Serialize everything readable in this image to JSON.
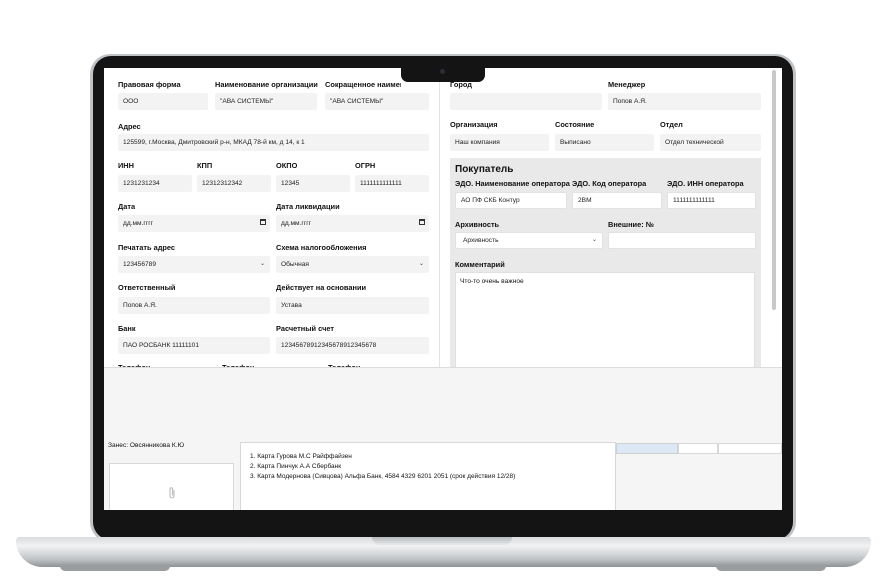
{
  "form": {
    "legal_form_label": "Правовая форма",
    "legal_form_value": "ООО",
    "org_name_label": "Наименование организации",
    "org_name_value": "\"АВА СИСТЕМЫ\"",
    "short_name_label": "Сокращенное наименование",
    "short_name_value": "\"АВА СИСТЕМЫ\"",
    "address_label": "Адрес",
    "address_value": "125599, г.Москва, Дмитровский р-н, МКАД 78-й км, д 14, к 1",
    "inn_label": "ИНН",
    "inn_value": "1231231234",
    "kpp_label": "КПП",
    "kpp_value": "12312312342",
    "okpo_label": "ОКПО",
    "okpo_value": "12345",
    "ogrn_label": "ОГРН",
    "ogrn_value": "1111111111111",
    "date_label": "Дата",
    "date_placeholder": "дд.мм.гггг",
    "liq_date_label": "Дата ликвидации",
    "liq_date_placeholder": "дд.мм.гггг",
    "print_address_label": "Печатать адрес",
    "print_address_value": "123456789",
    "tax_scheme_label": "Схема налогообложения",
    "tax_scheme_value": "Обычная",
    "responsible_label": "Ответственный",
    "responsible_value": "Попов А.Я.",
    "basis_label": "Действует на основании",
    "basis_value": "Устава",
    "bank_label": "Банк",
    "bank_value": "ПАО РОСБАНК 11111101",
    "account_label": "Расчетный счет",
    "account_value": "12345678912345678912345678",
    "phone_label": "Телефон"
  },
  "right": {
    "city_label": "Город",
    "manager_label": "Менеджер",
    "manager_value": "Попов А.Я.",
    "organization_label": "Организация",
    "organization_value": "Наш компания",
    "state_label": "Состояние",
    "state_value": "Выписано",
    "department_label": "Отдел",
    "department_value": "Отдел технической"
  },
  "buyer": {
    "title": "Покупатель",
    "edo_name_label": "ЭДО. Наименование оператора",
    "edo_name_value": "АО ПФ СКБ Контур",
    "edo_code_label": "ЭДО. Код оператора",
    "edo_code_value": "2ВМ",
    "edo_inn_label": "ЭДО. ИНН оператора",
    "edo_inn_value": "1111111111111",
    "archive_label": "Архивность",
    "archive_value": "Архивность",
    "external_label": "Внешние: №",
    "comment_label": "Комментарий",
    "comment_value": "Что-то очень важное"
  },
  "bottom": {
    "entered_by": "Занес: Овсянникова К.Ю",
    "cards": [
      "1. Карта Гурова М.С Райффайзен",
      "2. Карта Пинчук А.А Сбербанк",
      "3. Карта Модернова (Сивцова) Альфа Банк, 4584 4329 6201 2051 (срок действия 12/28)"
    ]
  },
  "colors": {
    "lid": "#141414",
    "field_bg": "#f3f3f3",
    "buyer_bg": "#e9e9e9",
    "tab_highlight": "#dde8f7"
  }
}
